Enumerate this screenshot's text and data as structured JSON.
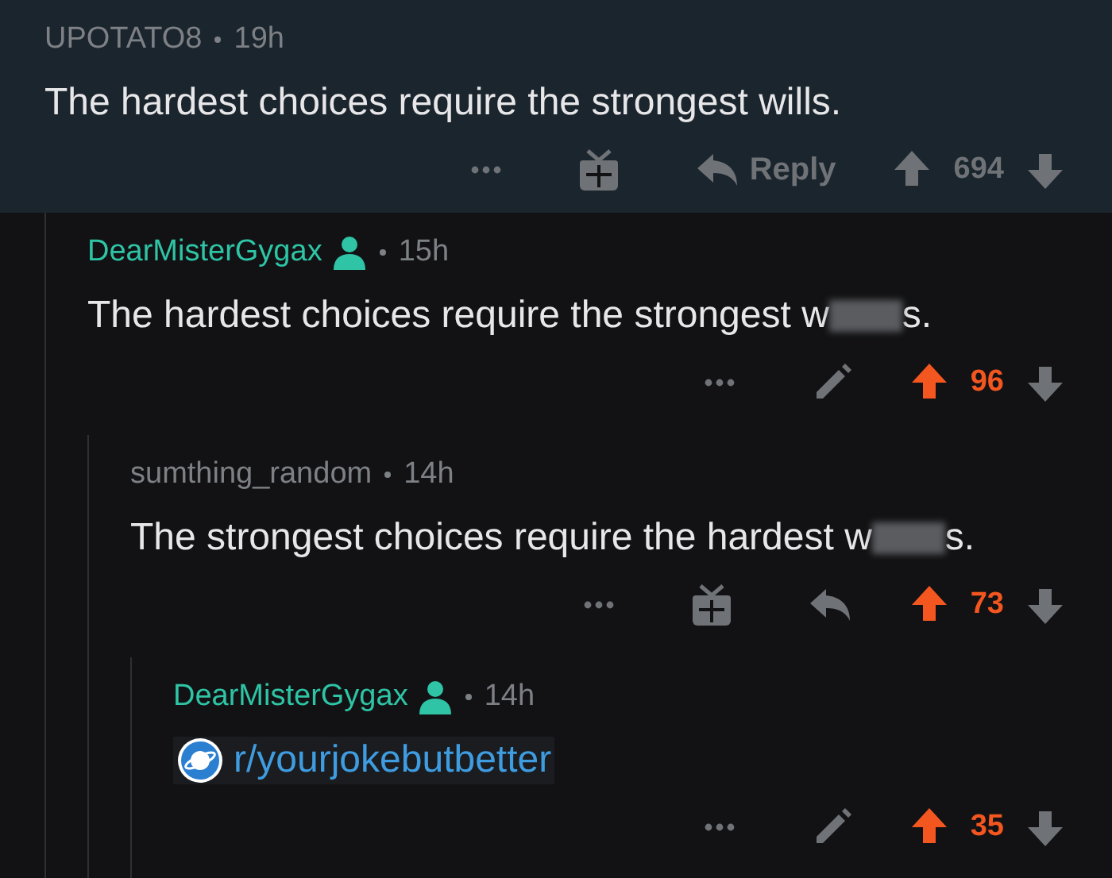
{
  "comments": [
    {
      "author": "UPOTATO8",
      "is_op": false,
      "time": "19h",
      "highlighted": true,
      "body": "The hardest choices require the strongest wills.",
      "actions": [
        {
          "kind": "more"
        },
        {
          "kind": "gift"
        },
        {
          "kind": "reply",
          "label": "Reply"
        }
      ],
      "score": {
        "value": "694",
        "upvoted": false
      },
      "children": [
        {
          "author": "DearMisterGygax",
          "is_op": true,
          "time": "15h",
          "highlighted": false,
          "body": "The hardest choices require the strongest w",
          "redacted": true,
          "body_tail": "s.",
          "actions": [
            {
              "kind": "more"
            },
            {
              "kind": "edit"
            }
          ],
          "score": {
            "value": "96",
            "upvoted": true
          },
          "children": [
            {
              "author": "sumthing_random",
              "is_op": false,
              "time": "14h",
              "highlighted": false,
              "body": "The strongest choices require the hardest w",
              "redacted": true,
              "body_tail": "s.",
              "actions": [
                {
                  "kind": "more"
                },
                {
                  "kind": "gift"
                },
                {
                  "kind": "reply"
                }
              ],
              "score": {
                "value": "73",
                "upvoted": true
              },
              "children": [
                {
                  "author": "DearMisterGygax",
                  "is_op": true,
                  "time": "14h",
                  "highlighted": false,
                  "link": {
                    "text": "r/yourjokebutbetter"
                  },
                  "actions": [
                    {
                      "kind": "more"
                    },
                    {
                      "kind": "edit"
                    }
                  ],
                  "score": {
                    "value": "35",
                    "upvoted": true
                  }
                }
              ]
            }
          ]
        }
      ]
    }
  ]
}
